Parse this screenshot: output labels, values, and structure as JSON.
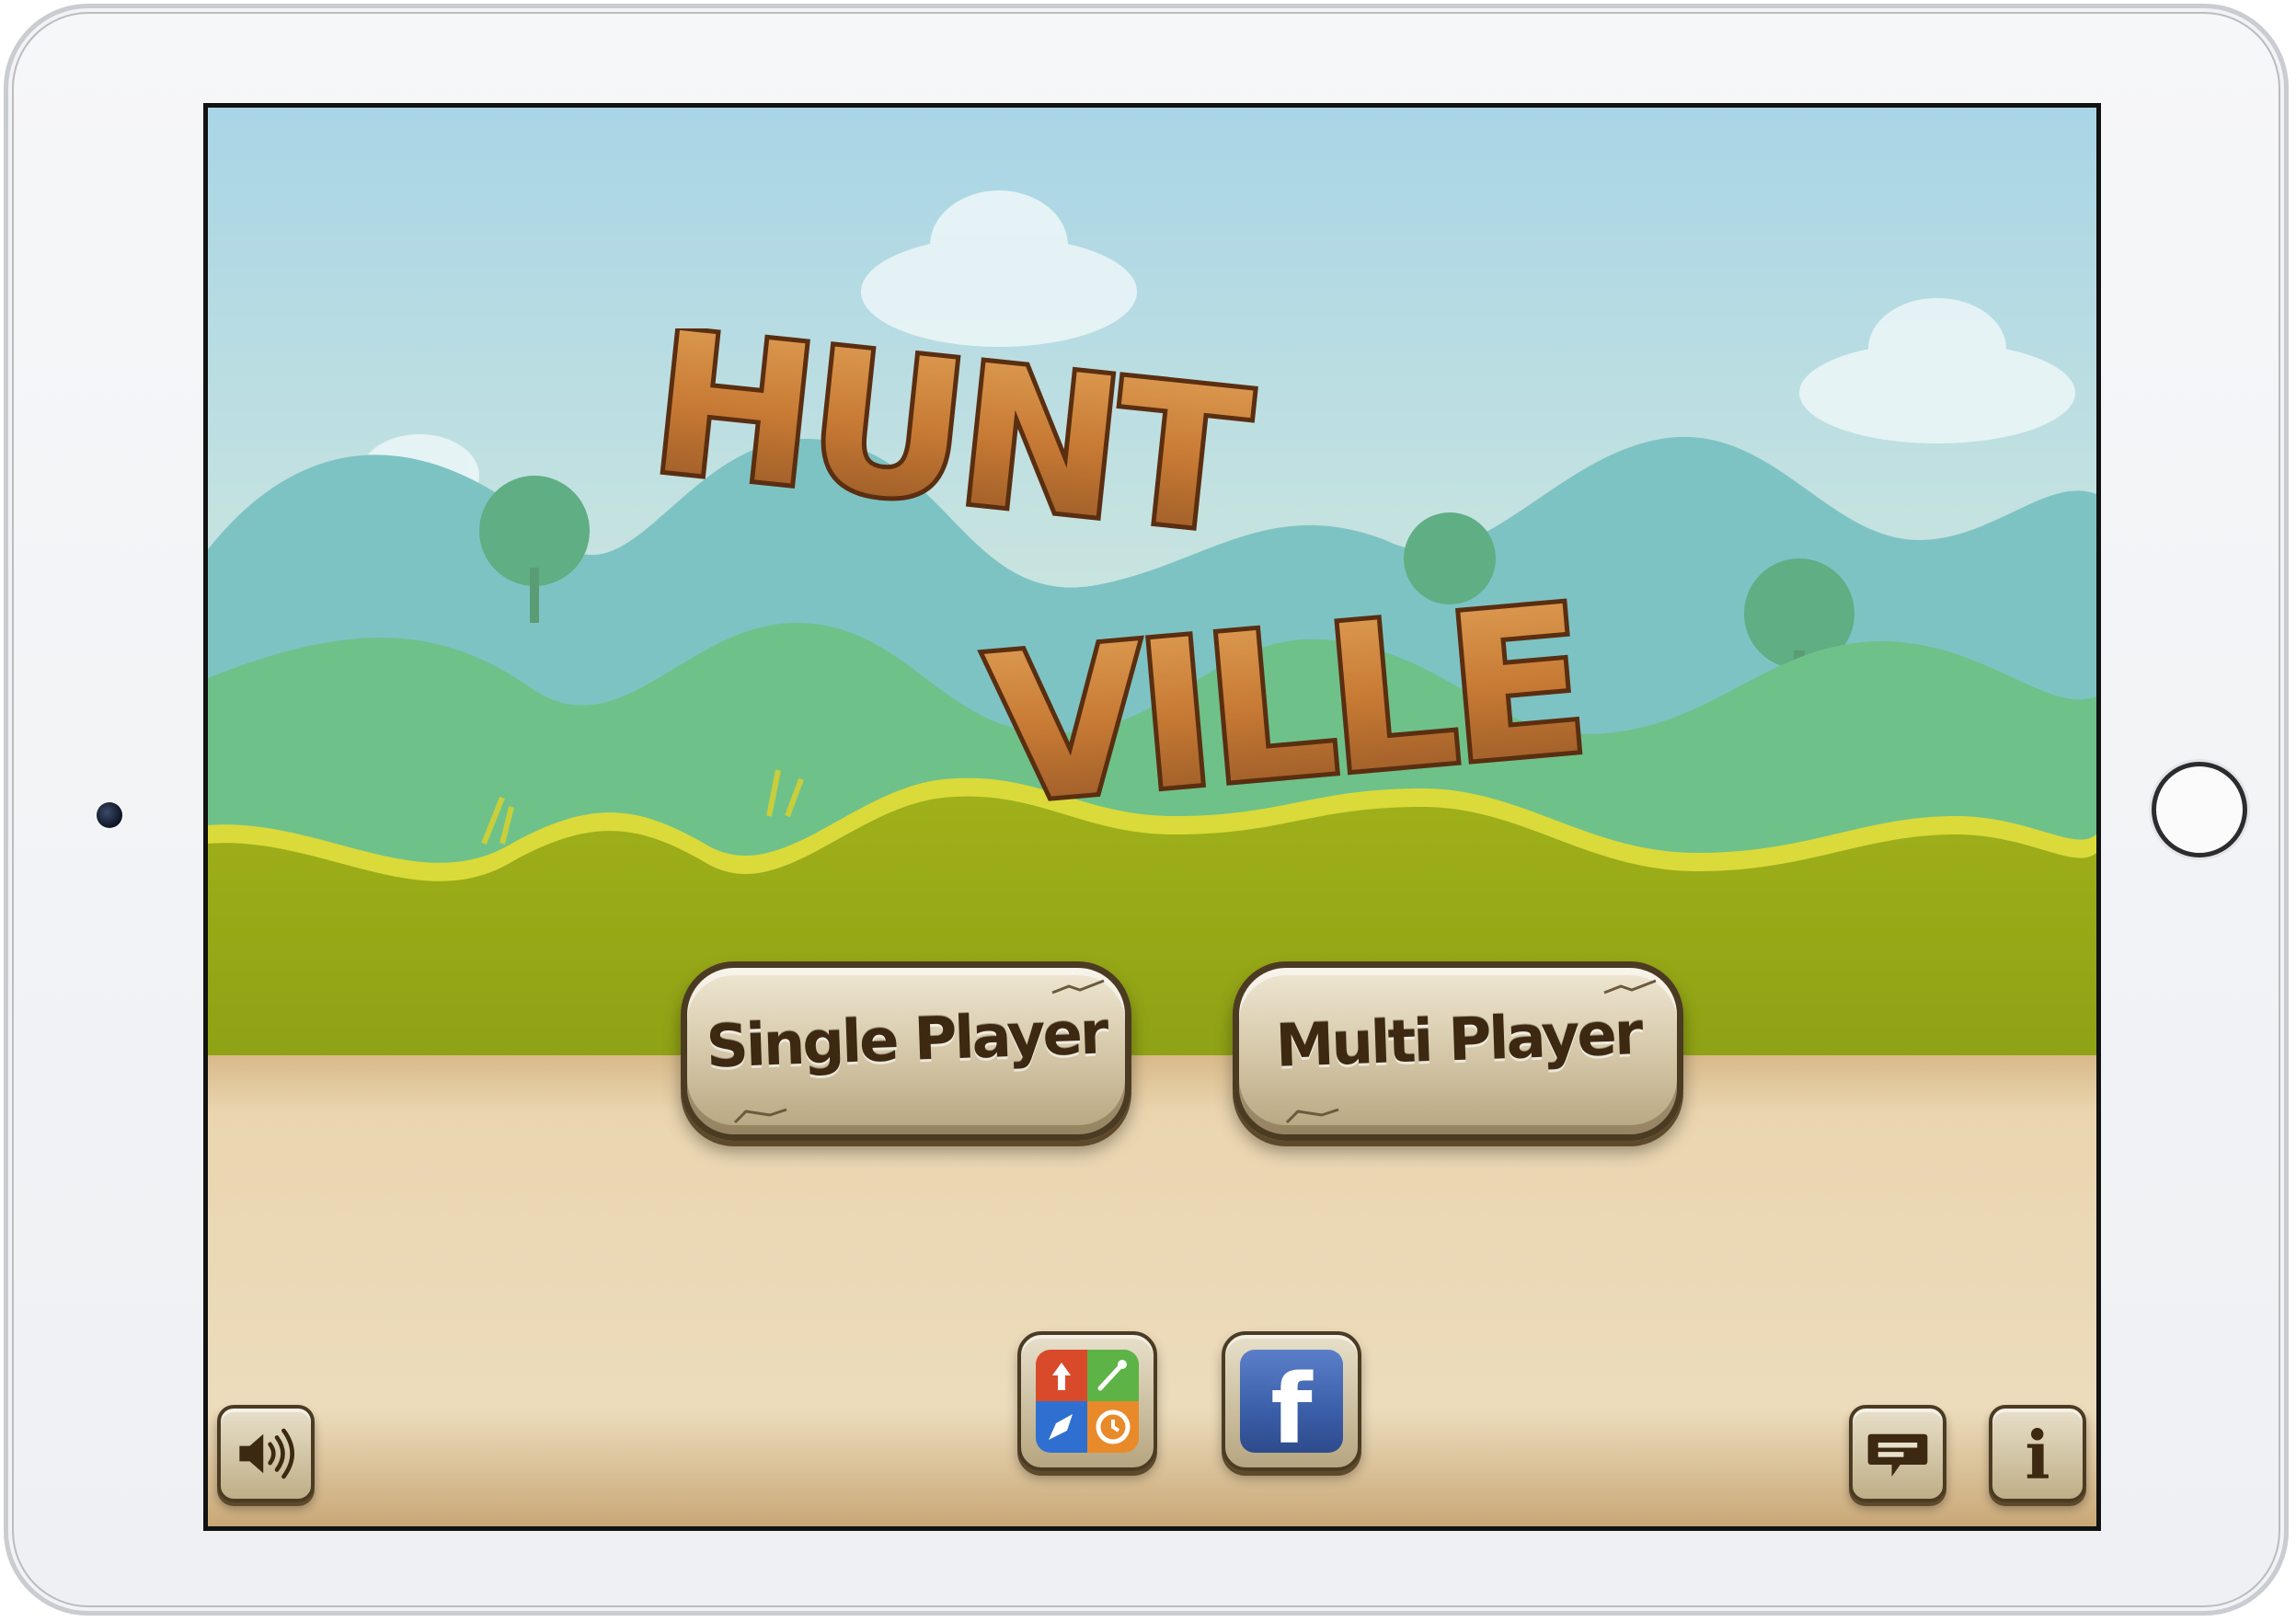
{
  "game": {
    "title_line1": "HUNT",
    "title_line2": "VILLE"
  },
  "menu": {
    "single_player_label": "Single Player",
    "multi_player_label": "Multi Player"
  },
  "toolbar": {
    "sound_icon": "speaker-icon",
    "game_center_icon": "game-center-icon",
    "facebook_icon": "facebook-icon",
    "facebook_glyph": "f",
    "feedback_icon": "chat-bubble-icon",
    "info_icon": "info-icon",
    "info_glyph": "i"
  },
  "colors": {
    "sky": "#bfe0e6",
    "ground": "#e7d0a8",
    "grass": "#a8b81c",
    "button_text": "#3d2812",
    "facebook_blue": "#3b5ea8"
  }
}
